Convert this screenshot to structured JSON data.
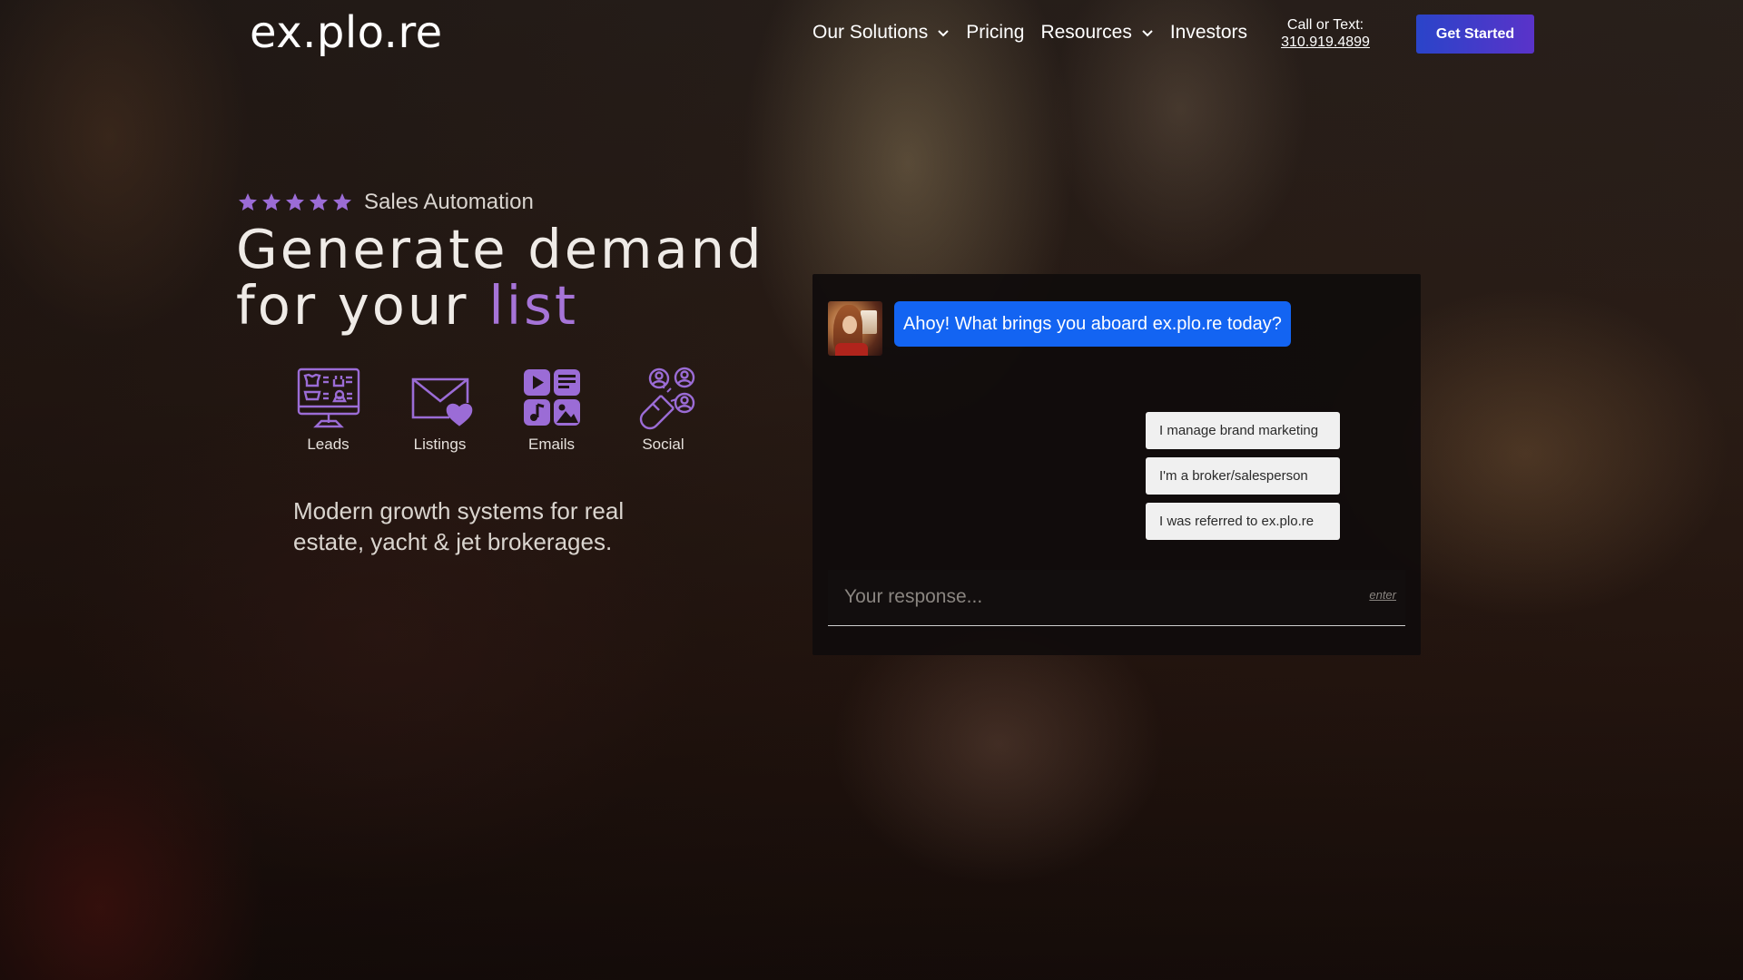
{
  "header": {
    "logo": "ex.plo.re",
    "nav": [
      {
        "label": "Our Solutions",
        "dropdown": true
      },
      {
        "label": "Pricing",
        "dropdown": false
      },
      {
        "label": "Resources",
        "dropdown": true
      },
      {
        "label": "Investors",
        "dropdown": false
      }
    ],
    "call_label": "Call or Text:",
    "phone": "310.919.4899",
    "cta_label": "Get Started"
  },
  "hero": {
    "rating_stars": 5,
    "rating_label": "Sales Automation",
    "headline_line1": "Generate demand",
    "headline_line2_prefix": "for your ",
    "headline_accent": "list",
    "features": [
      {
        "label": "Leads",
        "icon": "monitor-store-icon"
      },
      {
        "label": "Listings",
        "icon": "envelope-heart-icon"
      },
      {
        "label": "Emails",
        "icon": "media-apps-icon"
      },
      {
        "label": "Social",
        "icon": "magnet-users-icon"
      }
    ],
    "tagline": "Modern growth systems for real estate, yacht & jet brokerages."
  },
  "chat": {
    "message": "Ahoy! What brings you aboard ex.plo.re today?",
    "options": [
      "I manage brand marketing",
      "I'm a broker/salesperson",
      "I was referred to ex.plo.re"
    ],
    "input_placeholder": "Your response...",
    "enter_label": "enter"
  },
  "colors": {
    "accent_purple": "#a674d8",
    "bubble_blue": "#1364f2",
    "cta_gradient_start": "#2a44c9",
    "cta_gradient_end": "#5a33c9"
  }
}
